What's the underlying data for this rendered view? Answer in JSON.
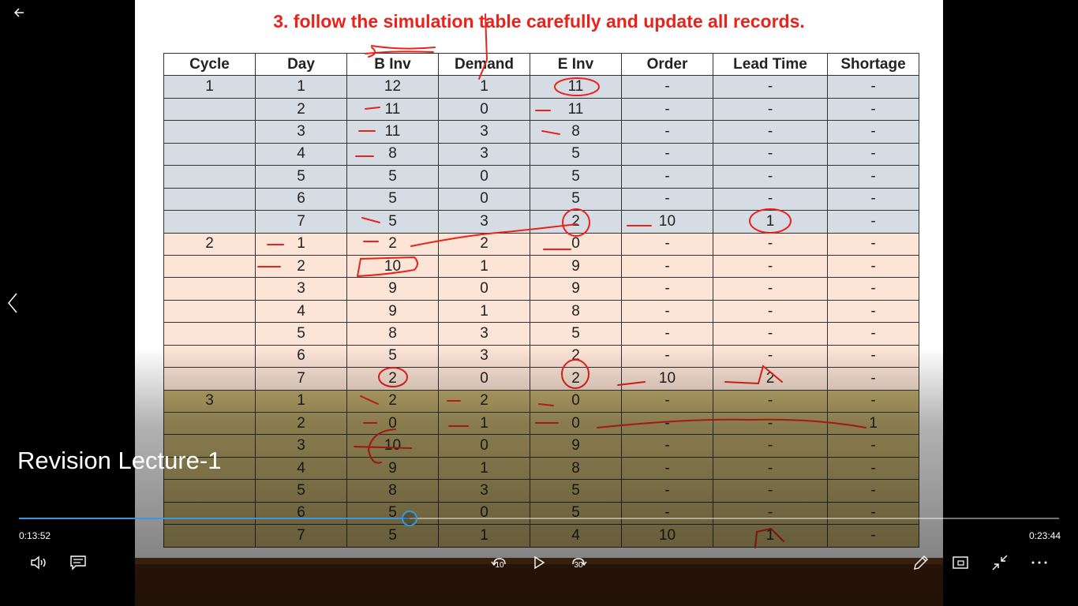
{
  "nav": {
    "back_icon": "back-arrow-icon",
    "previous_icon": "chevron-left-icon"
  },
  "slide": {
    "title": "3. follow the simulation table carefully and update all records.",
    "headers": [
      "Cycle",
      "Day",
      "B Inv",
      "Demand",
      "E Inv",
      "Order",
      "Lead Time",
      "Shortage"
    ],
    "rows": [
      {
        "cycle": "1",
        "day": "1",
        "binv": "12",
        "demand": "1",
        "einv": "11",
        "order": "-",
        "lead": "-",
        "short": "-"
      },
      {
        "cycle": "",
        "day": "2",
        "binv": "11",
        "demand": "0",
        "einv": "11",
        "order": "-",
        "lead": "-",
        "short": "-"
      },
      {
        "cycle": "",
        "day": "3",
        "binv": "11",
        "demand": "3",
        "einv": "8",
        "order": "-",
        "lead": "-",
        "short": "-"
      },
      {
        "cycle": "",
        "day": "4",
        "binv": "8",
        "demand": "3",
        "einv": "5",
        "order": "-",
        "lead": "-",
        "short": "-"
      },
      {
        "cycle": "",
        "day": "5",
        "binv": "5",
        "demand": "0",
        "einv": "5",
        "order": "-",
        "lead": "-",
        "short": "-"
      },
      {
        "cycle": "",
        "day": "6",
        "binv": "5",
        "demand": "0",
        "einv": "5",
        "order": "-",
        "lead": "-",
        "short": "-"
      },
      {
        "cycle": "",
        "day": "7",
        "binv": "5",
        "demand": "3",
        "einv": "2",
        "order": "10",
        "lead": "1",
        "short": "-"
      },
      {
        "cycle": "2",
        "day": "1",
        "binv": "2",
        "demand": "2",
        "einv": "0",
        "order": "-",
        "lead": "-",
        "short": "-"
      },
      {
        "cycle": "",
        "day": "2",
        "binv": "10",
        "demand": "1",
        "einv": "9",
        "order": "-",
        "lead": "-",
        "short": "-"
      },
      {
        "cycle": "",
        "day": "3",
        "binv": "9",
        "demand": "0",
        "einv": "9",
        "order": "-",
        "lead": "-",
        "short": "-"
      },
      {
        "cycle": "",
        "day": "4",
        "binv": "9",
        "demand": "1",
        "einv": "8",
        "order": "-",
        "lead": "-",
        "short": "-"
      },
      {
        "cycle": "",
        "day": "5",
        "binv": "8",
        "demand": "3",
        "einv": "5",
        "order": "-",
        "lead": "-",
        "short": "-"
      },
      {
        "cycle": "",
        "day": "6",
        "binv": "5",
        "demand": "3",
        "einv": "2",
        "order": "-",
        "lead": "-",
        "short": "-"
      },
      {
        "cycle": "",
        "day": "7",
        "binv": "2",
        "demand": "0",
        "einv": "2",
        "order": "10",
        "lead": "2",
        "short": "-"
      },
      {
        "cycle": "3",
        "day": "1",
        "binv": "2",
        "demand": "2",
        "einv": "0",
        "order": "-",
        "lead": "-",
        "short": "-"
      },
      {
        "cycle": "",
        "day": "2",
        "binv": "0",
        "demand": "1",
        "einv": "0",
        "order": "-",
        "lead": "-",
        "short": "1"
      },
      {
        "cycle": "",
        "day": "3",
        "binv": "10",
        "demand": "0",
        "einv": "9",
        "order": "-",
        "lead": "-",
        "short": "-"
      },
      {
        "cycle": "",
        "day": "4",
        "binv": "9",
        "demand": "1",
        "einv": "8",
        "order": "-",
        "lead": "-",
        "short": "-"
      },
      {
        "cycle": "",
        "day": "5",
        "binv": "8",
        "demand": "3",
        "einv": "5",
        "order": "-",
        "lead": "-",
        "short": "-"
      },
      {
        "cycle": "",
        "day": "6",
        "binv": "5",
        "demand": "0",
        "einv": "5",
        "order": "-",
        "lead": "-",
        "short": "-"
      },
      {
        "cycle": "",
        "day": "7",
        "binv": "5",
        "demand": "1",
        "einv": "4",
        "order": "10",
        "lead": "1",
        "short": "-"
      }
    ],
    "row_colors": [
      "#d6dce4",
      "#fce4d6",
      "#c3b06f"
    ],
    "ink_color": "#e8231c"
  },
  "player": {
    "video_title": "Revision Lecture-1",
    "current_time": "0:13:52",
    "total_time": "0:23:44",
    "progress_fraction": 0.3757,
    "accent_color": "#3a96dd",
    "skip_back_seconds": "10",
    "skip_forward_seconds": "30",
    "controls": [
      "volume-icon",
      "captions-icon",
      "skip-back-icon",
      "play-icon",
      "skip-forward-icon",
      "pen-icon",
      "mini-view-icon",
      "exit-fullscreen-icon",
      "more-icon"
    ]
  }
}
